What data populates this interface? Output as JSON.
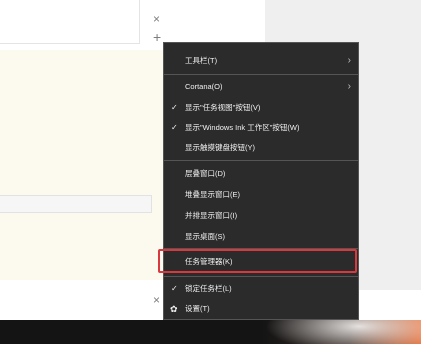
{
  "background": {
    "close_glyph": "×",
    "add_glyph": "+"
  },
  "menu": {
    "items": [
      {
        "label": "工具栏(T)",
        "has_submenu": true,
        "checked": false
      },
      {
        "label": "Cortana(O)",
        "has_submenu": true,
        "checked": false
      },
      {
        "label": "显示\"任务视图\"按钮(V)",
        "has_submenu": false,
        "checked": true
      },
      {
        "label": "显示\"Windows Ink 工作区\"按钮(W)",
        "has_submenu": false,
        "checked": true
      },
      {
        "label": "显示触摸键盘按钮(Y)",
        "has_submenu": false,
        "checked": false
      },
      {
        "label": "层叠窗口(D)",
        "has_submenu": false,
        "checked": false
      },
      {
        "label": "堆叠显示窗口(E)",
        "has_submenu": false,
        "checked": false
      },
      {
        "label": "并排显示窗口(I)",
        "has_submenu": false,
        "checked": false
      },
      {
        "label": "显示桌面(S)",
        "has_submenu": false,
        "checked": false
      },
      {
        "label": "任务管理器(K)",
        "has_submenu": false,
        "checked": false,
        "highlighted": true
      },
      {
        "label": "锁定任务栏(L)",
        "has_submenu": false,
        "checked": true
      },
      {
        "label": "设置(T)",
        "has_submenu": false,
        "checked": false,
        "icon": "gear-icon"
      }
    ],
    "check_glyph": "✓",
    "arrow_glyph": "›",
    "gear_glyph": "✿"
  },
  "colors": {
    "menu_bg": "#2b2b2b",
    "highlight_border": "#d9393e",
    "taskbar": "#141414"
  }
}
